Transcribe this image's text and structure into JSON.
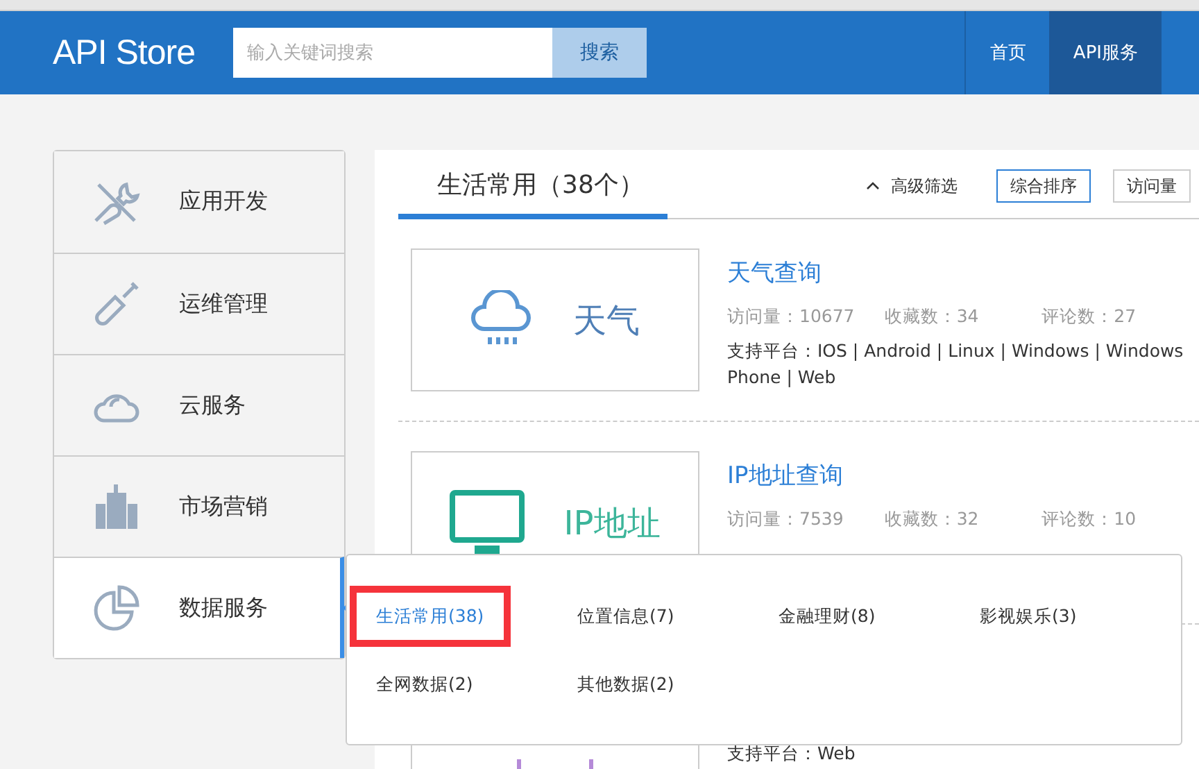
{
  "header": {
    "logo": "API Store",
    "search": {
      "placeholder": "输入关键词搜索",
      "button": "搜索"
    },
    "nav": [
      {
        "label": "首页",
        "selected": false
      },
      {
        "label": "API服务",
        "selected": true
      }
    ]
  },
  "sidebar": {
    "items": [
      {
        "label": "应用开发",
        "kind": "tools",
        "selected": false
      },
      {
        "label": "运维管理",
        "kind": "screwdriver",
        "selected": false
      },
      {
        "label": "云服务",
        "kind": "cloud",
        "selected": false
      },
      {
        "label": "市场营销",
        "kind": "building",
        "selected": false
      },
      {
        "label": "数据服务",
        "kind": "pie",
        "selected": true
      }
    ]
  },
  "main": {
    "tab": "生活常用（38个）",
    "filter": "高级筛选",
    "sort": [
      {
        "label": "综合排序",
        "selected": true
      },
      {
        "label": "访问量",
        "selected": false
      }
    ],
    "apis": [
      {
        "kind": "weather",
        "image_text": "天气",
        "title": "天气查询",
        "stats": [
          "访问量：10677",
          "收藏数：34",
          "评论数：27"
        ],
        "platforms": "支持平台：IOS | Android | Linux | Windows | Windows Phone | Web"
      },
      {
        "kind": "ip",
        "image_text": "IP地址",
        "title": "IP地址查询",
        "stats": [
          "访问量：7539",
          "收藏数：32",
          "评论数：10"
        ]
      },
      {
        "kind": "purple",
        "platforms": "支持平台：Web"
      }
    ]
  },
  "popup": {
    "items": [
      {
        "label": "生活常用(38)",
        "selected": true
      },
      {
        "label": "位置信息(7)",
        "selected": false
      },
      {
        "label": "金融理财(8)",
        "selected": false
      },
      {
        "label": "影视娱乐(3)",
        "selected": false
      },
      {
        "label": "全网数据(2)",
        "selected": false
      },
      {
        "label": "其他数据(2)",
        "selected": false
      }
    ]
  }
}
